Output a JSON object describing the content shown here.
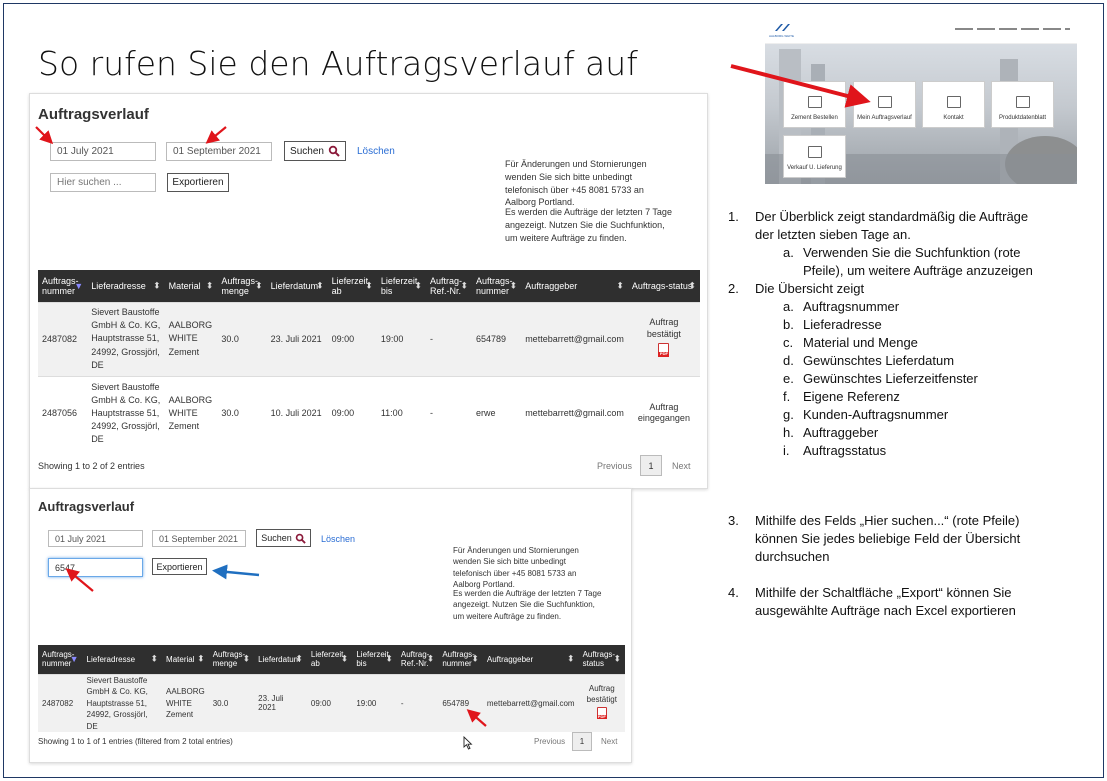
{
  "slide": {
    "title": "So rufen Sie den Auftragsverlauf auf"
  },
  "panel1": {
    "heading": "Auftragsverlauf",
    "date_from": "01 July 2021",
    "date_to": "01 September 2021",
    "search_label": "Suchen",
    "clear_label": "Löschen",
    "search_placeholder": "Hier suchen ...",
    "export_label": "Exportieren",
    "note_1": "Für Änderungen und Stornierungen wenden Sie sich bitte unbedingt telefonisch über +45 8081 5733 an Aalborg Portland.",
    "note_2": "Es werden die Aufträge der letzten 7 Tage angezeigt. Nutzen Sie die Suchfunktion, um weitere Aufträge zu finden.",
    "headers": [
      "Auftrags-nummer",
      "Lieferadresse",
      "Material",
      "Auftrags-menge",
      "Lieferdatum",
      "Lieferzeit ab",
      "Lieferzeit bis",
      "Auftrag-Ref.-Nr.",
      "Auftrags-nummer",
      "Auftraggeber",
      "Auftrags-status"
    ],
    "rows": [
      {
        "nr": "2487082",
        "address": "Sievert Baustoffe GmbH & Co. KG, Hauptstrasse 51, 24992, Grossjörl, DE",
        "material": "AALBORG WHITE Zement",
        "menge": "30.0",
        "datum": "23. Juli 2021",
        "ab": "09:00",
        "bis": "19:00",
        "ref": "-",
        "kunde": "654789",
        "auftraggeber": "mettebarrett@gmail.com",
        "status": "Auftrag bestätigt",
        "pdf": "PDF"
      },
      {
        "nr": "2487056",
        "address": "Sievert Baustoffe GmbH & Co. KG, Hauptstrasse 51, 24992, Grossjörl, DE",
        "material": "AALBORG WHITE Zement",
        "menge": "30.0",
        "datum": "10. Juli 2021",
        "ab": "09:00",
        "bis": "11:00",
        "ref": "-",
        "kunde": "erwe",
        "auftraggeber": "mettebarrett@gmail.com",
        "status": "Auftrag eingegangen",
        "pdf": ""
      }
    ],
    "footer": "Showing 1 to 2 of 2 entries",
    "prev": "Previous",
    "page": "1",
    "next": "Next"
  },
  "panel2": {
    "heading": "Auftragsverlauf",
    "date_from": "01 July 2021",
    "date_to": "01 September 2021",
    "search_label": "Suchen",
    "clear_label": "Löschen",
    "search_value": "6547",
    "export_label": "Exportieren",
    "note_1": "Für Änderungen und Stornierungen wenden Sie sich bitte unbedingt telefonisch über +45 8081 5733 an Aalborg Portland.",
    "note_2": "Es werden die Aufträge der letzten 7 Tage angezeigt. Nutzen Sie die Suchfunktion, um weitere Aufträge zu finden.",
    "headers": [
      "Auftrags-nummer",
      "Lieferadresse",
      "Material",
      "Auftrags-menge",
      "Lieferdatum",
      "Lieferzeit ab",
      "Lieferzeit bis",
      "Auftrag-Ref.-Nr.",
      "Auftrags-nummer",
      "Auftraggeber",
      "Auftrags-status"
    ],
    "rows": [
      {
        "nr": "2487082",
        "address": "Sievert Baustoffe GmbH & Co. KG, Hauptstrasse 51, 24992, Grossjörl, DE",
        "material": "AALBORG WHITE Zement",
        "menge": "30.0",
        "datum": "23. Juli 2021",
        "ab": "09:00",
        "bis": "19:00",
        "ref": "-",
        "kunde": "654789",
        "auftraggeber": "mettebarrett@gmail.com",
        "status": "Auftrag bestätigt",
        "pdf": "PDF"
      }
    ],
    "footer": "Showing 1 to 1 of 1 entries (filtered from 2 total entries)",
    "prev": "Previous",
    "page": "1",
    "next": "Next"
  },
  "thumb": {
    "brand": "AALBORG WHITE",
    "tiles": [
      "Zement Bestellen",
      "Mein Auftragsverlauf",
      "Kontakt",
      "Produktdatenblatt",
      "Verkauf U. Lieferung"
    ]
  },
  "instructions": {
    "item1": "1.",
    "item1_text_a": "Der Überblick zeigt standardmäßig die Aufträge",
    "item1_text_b": "der letzten sieben Tage an.",
    "item1a_m": "a.",
    "item1a_a": "Verwenden Sie die Suchfunktion (rote",
    "item1a_b": "Pfeile), um weitere Aufträge anzuzeigen",
    "item2": "2.",
    "item2_text": "Die Übersicht zeigt",
    "sub": [
      {
        "m": "a.",
        "t": "Auftragsnummer"
      },
      {
        "m": "b.",
        "t": "Lieferadresse"
      },
      {
        "m": "c.",
        "t": "Material und Menge"
      },
      {
        "m": "d.",
        "t": "Gewünschtes Lieferdatum"
      },
      {
        "m": "e.",
        "t": "Gewünschtes Lieferzeitfenster"
      },
      {
        "m": "f.",
        "t": "Eigene Referenz"
      },
      {
        "m": "g.",
        "t": "Kunden-Auftragsnummer"
      },
      {
        "m": "h.",
        "t": "Auftraggeber"
      },
      {
        "m": "i.",
        "t": "Auftragsstatus"
      }
    ],
    "item3": "3.",
    "item3_a": "Mithilfe des Felds „Hier suchen...“ (rote Pfeile)",
    "item3_b": "können Sie jedes beliebige Feld der Übersicht",
    "item3_c": "durchsuchen",
    "item4": "4.",
    "item4_a": "Mithilfe der Schaltfläche „Export“ können Sie",
    "item4_b": "ausgewählte Aufträge nach Excel exportieren"
  },
  "colors": {
    "arrow_red": "#e0151b",
    "arrow_blue": "#1f6fc0",
    "table_header": "#2f2f2f",
    "link": "#2a6dd4",
    "frame": "#1f3864"
  }
}
